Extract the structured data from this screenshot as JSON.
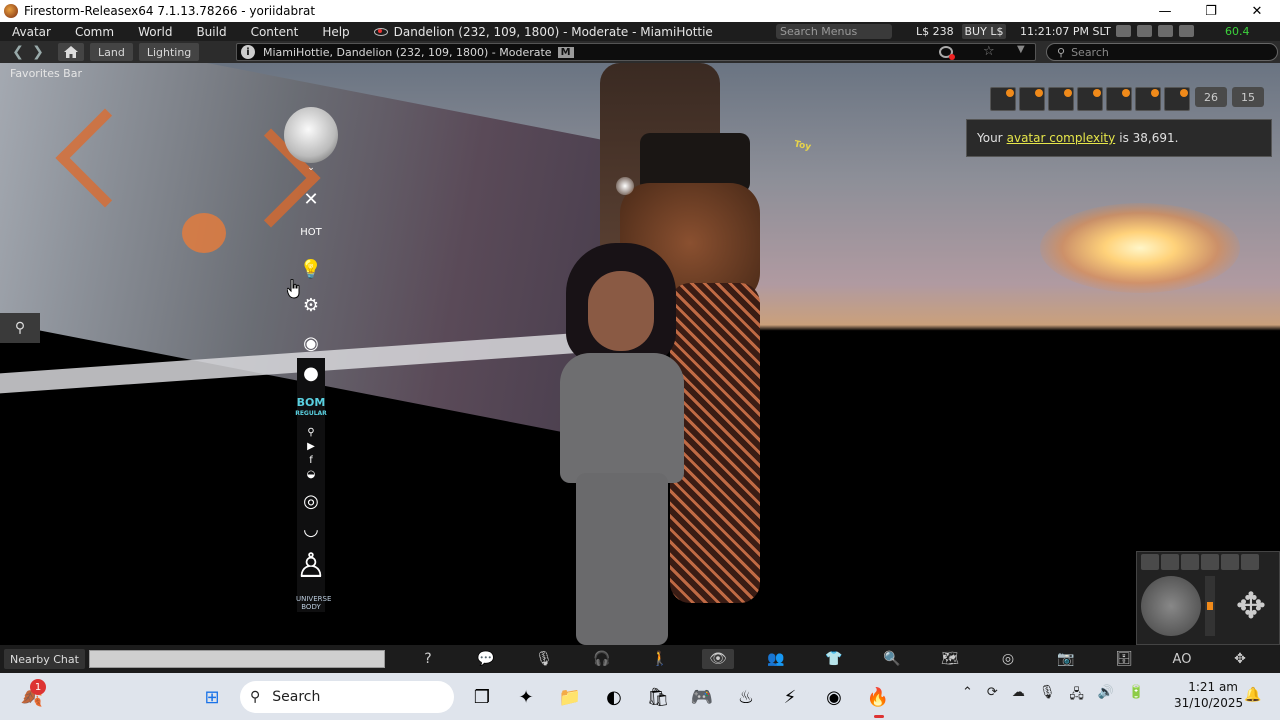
{
  "window": {
    "title": "Firestorm-Releasex64 7.1.13.78266 - yoriidabrat",
    "minimize": "—",
    "maximize": "❐",
    "close": "✕"
  },
  "menubar": {
    "menus": [
      "Avatar",
      "Comm",
      "World",
      "Build",
      "Content",
      "Help"
    ],
    "region": "Dandelion (232, 109, 1800) - Moderate - MiamiHottie",
    "search_menus_placeholder": "Search Menus",
    "balance": "L$ 238",
    "buy_label": "BUY L$",
    "clock": "11:21:07 PM SLT",
    "fps": "60.4"
  },
  "navbar": {
    "back": "❮",
    "forward": "❯",
    "land_label": "Land",
    "lighting_label": "Lighting",
    "location": "MiamiHottie, Dandelion (232, 109, 1800) - Moderate",
    "maturity_badge": "M",
    "search_placeholder": "Search"
  },
  "viewport": {
    "favorites_bar": "Favorites Bar",
    "decal_text": "Toy",
    "hud_bom_line1": "BOM",
    "hud_bom_line2": "REGULAR",
    "hud_body_line1": "UNIVERSE",
    "hud_body_line2": "BODY",
    "hud_small_label": "HOT"
  },
  "notifications": {
    "count_a": "26",
    "count_b": "15",
    "complexity_prefix": "Your",
    "complexity_link": "avatar complexity",
    "complexity_suffix": "is 38,691."
  },
  "bottombar": {
    "chat_label": "Nearby Chat",
    "ao_label": "AO"
  },
  "taskbar": {
    "search_placeholder": "Search",
    "time": "1:21 am",
    "date": "31/10/2025",
    "badge_count": "1"
  },
  "colors": {
    "fps_green": "#3cd23c",
    "link_yellow": "#e6e64a",
    "accent_orange": "#f08a1a"
  }
}
